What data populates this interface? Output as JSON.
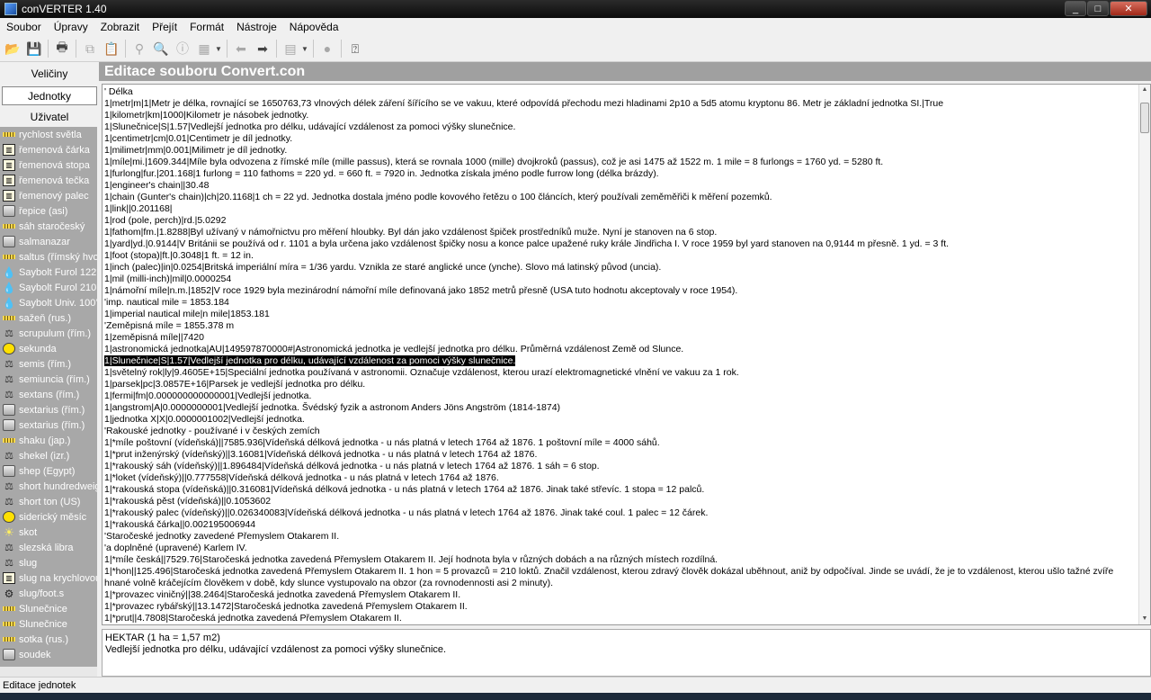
{
  "window": {
    "title": "conVERTER 1.40",
    "min": "_",
    "max": "□",
    "close": "✕"
  },
  "menu": [
    "Soubor",
    "Úpravy",
    "Zobrazit",
    "Přejít",
    "Formát",
    "Nástroje",
    "Nápověda"
  ],
  "left": {
    "tabs": [
      "Veličiny",
      "Jednotky",
      "Uživatel"
    ],
    "units": [
      {
        "label": "rychlost světla",
        "icon": "ruler"
      },
      {
        "label": "řemenová čárka",
        "icon": "frame"
      },
      {
        "label": "řemenová stopa",
        "icon": "frame"
      },
      {
        "label": "řemenová tečka",
        "icon": "frame"
      },
      {
        "label": "řemenový palec",
        "icon": "frame"
      },
      {
        "label": "řepice (asi)",
        "icon": "jar"
      },
      {
        "label": "sáh staročeský",
        "icon": "ruler"
      },
      {
        "label": "salmanazar",
        "icon": "jar"
      },
      {
        "label": "saltus (římský hvozd)",
        "icon": "ruler"
      },
      {
        "label": "Saybolt Furol 122°F",
        "icon": "drop"
      },
      {
        "label": "Saybolt Furol 210°F",
        "icon": "drop"
      },
      {
        "label": "Saybolt Univ. 100°F",
        "icon": "drop"
      },
      {
        "label": "sažeň (rus.)",
        "icon": "ruler"
      },
      {
        "label": "scrupulum (řím.)",
        "icon": "scale"
      },
      {
        "label": "sekunda",
        "icon": "clock"
      },
      {
        "label": "semis (řím.)",
        "icon": "scale"
      },
      {
        "label": "semiuncia (řím.)",
        "icon": "scale"
      },
      {
        "label": "sextans (řím.)",
        "icon": "scale"
      },
      {
        "label": "sextarius (řím.)",
        "icon": "jar"
      },
      {
        "label": "sextarius (řím.)",
        "icon": "jar"
      },
      {
        "label": "shaku (jap.)",
        "icon": "ruler"
      },
      {
        "label": "shekel (izr.)",
        "icon": "scale"
      },
      {
        "label": "shep (Egypt)",
        "icon": "jar"
      },
      {
        "label": "short hundredweight",
        "icon": "scale"
      },
      {
        "label": "short ton (US)",
        "icon": "scale"
      },
      {
        "label": "siderický měsíc",
        "icon": "clock"
      },
      {
        "label": "skot",
        "icon": "sun"
      },
      {
        "label": "slezská libra",
        "icon": "scale"
      },
      {
        "label": "slug",
        "icon": "scale"
      },
      {
        "label": "slug na krychlovou stopu",
        "icon": "frame"
      },
      {
        "label": "slug/foot.s",
        "icon": "gear"
      },
      {
        "label": "Slunečnice",
        "icon": "ruler"
      },
      {
        "label": "Slunečnice",
        "icon": "ruler"
      },
      {
        "label": "sotka (rus.)",
        "icon": "ruler"
      },
      {
        "label": "soudek",
        "icon": "jar"
      }
    ]
  },
  "main": {
    "header": "Editace souboru Convert.con",
    "lines": [
      "' Délka",
      "1|metr|m|1|Metr je délka, rovnající se 1650763,73 vlnových délek záření šířícího se ve vakuu, které odpovídá přechodu mezi hladinami 2p10 a 5d5 atomu kryptonu 86. Metr je základní jednotka SI.|True",
      "1|kilometr|km|1000|Kilometr je násobek jednotky.",
      "1|Slunečnice|S|1.57|Vedlejší jednotka pro délku, udávající vzdálenost za pomoci výšky slunečnice.",
      "1|centimetr|cm|0.01|Centimetr je díl jednotky.",
      "1|milimetr|mm|0.001|Milimetr je díl jednotky.",
      "1|míle|mi.|1609.344|Míle byla odvozena z římské míle (mille passus), která se rovnala 1000 (mille) dvojkroků (passus), což je asi 1475 až 1522 m. 1 mile = 8 furlongs = 1760 yd. = 5280 ft.",
      "1|furlong|fur.|201.168|1 furlong = 110 fathoms = 220 yd. = 660 ft. = 7920 in. Jednotka získala jméno podle furrow long (délka brázdy).",
      "1|engineer's chain||30.48",
      "1|chain (Gunter's chain)|ch|20.1168|1 ch = 22 yd. Jednotka dostala jméno podle kovového řetězu o 100 článcích, který používali zeměměřiči k měření pozemků.",
      "1|link||0.201168|",
      "1|rod (pole, perch)|rd.|5.0292",
      "1|fathom|fm.|1.8288|Byl užívaný v námořnictvu pro měření hloubky. Byl dán jako vzdálenost špiček prostředníků muže. Nyní je stanoven na 6 stop.",
      "1|yard|yd.|0.9144|V Británii se používá od r. 1101 a byla určena jako vzdálenost špičky nosu a konce palce upažené ruky krále Jindřicha I. V roce 1959 byl yard stanoven na 0,9144 m přesně. 1 yd. = 3 ft.",
      "1|foot (stopa)|ft.|0.3048|1 ft. = 12 in.",
      "1|inch (palec)|in|0.0254|Britská imperiální míra = 1/36 yardu. Vznikla ze staré anglické unce (ynche). Slovo má latinský původ (uncia).",
      "1|mil (milli-inch)|mil|0.0000254",
      "1|námořní míle|n.m.|1852|V roce 1929 byla mezinárodní námořní míle definovaná jako 1852 metrů přesně (USA tuto hodnotu akceptovaly v roce 1954).",
      "'imp. nautical mile = 1853.184",
      "1|imperial nautical mile|n mile|1853.181",
      "'Zeměpisná míle = 1855.378 m",
      "1|zeměpisná míle||7420",
      "1|astronomická jednotka|AU|149597870000#|Astronomická jednotka je vedlejší jednotka pro délku. Průměrná vzdálenost Země od Slunce.",
      "1|Slunečnice|S|1.57|Vedlejší jednotka pro délku, udávající vzdálenost za pomoci výšky slunečnice.",
      "1|světelný rok|ly|9.4605E+15|Speciální jednotka používaná v astronomii. Označuje vzdálenost, kterou urazí elektromagnetické vlnění ve vakuu za 1 rok.",
      "1|parsek|pc|3.0857E+16|Parsek je vedlejší jednotka pro délku.",
      "1|fermi|fm|0.000000000000001|Vedlejší jednotka.",
      "1|angstrom|A|0.0000000001|Vedlejší jednotka. Švédský fyzik a astronom Anders Jöns Angström (1814-1874)",
      "1|jednotka X|X|0.0000001002|Vedlejší jednotka.",
      "'Rakouské jednotky - používané i v českých zemích",
      "1|*míle poštovní (vídeňská)||7585.936|Vídeňská délková jednotka - u nás platná v letech 1764 až 1876. 1 poštovní míle = 4000 sáhů.",
      "1|*prut inženýrský (vídeňský)||3.16081|Vídeňská délková jednotka - u nás platná v letech 1764 až 1876.",
      "1|*rakouský sáh (vídeňský)||1.896484|Vídeňská délková jednotka - u nás platná v letech 1764 až 1876. 1 sáh = 6 stop.",
      "1|*loket (vídeňský)||0.777558|Vídeňská délková jednotka - u nás platná v letech 1764 až 1876.",
      "1|*rakouská stopa (vídeňská)||0.316081|Vídeňská délková jednotka - u nás platná v letech 1764 až 1876. Jinak také střevíc. 1 stopa = 12 palců.",
      "1|*rakouská pěst (vídeňská)||0.1053602",
      "1|*rakouský palec (vídeňský)||0.026340083|Vídeňská délková jednotka - u nás platná v letech 1764 až 1876. Jinak také coul. 1 palec = 12 čárek.",
      "1|*rakouská čárka||0.002195006944",
      "'Staročeské jednotky zavedené Přemyslem Otakarem II.",
      "'a doplněné (upravené) Karlem IV.",
      "1|*míle česká||7529.76|Staročeská jednotka zavedená Přemyslem Otakarem II. Její hodnota byla v různých dobách a na různých místech rozdílná.",
      "1|*hon||125.496|Staročeská jednotka zavedená Přemyslem Otakarem II. 1 hon = 5 provazců = 210 loktů. Značil vzdálenost, kterou zdravý člověk dokázal uběhnout, aniž by odpočíval. Jinde se uvádí, že je to vzdálenost, kterou ušlo tažné zvíře hnané volně kráčejícím člověkem v době, kdy slunce vystupovalo na obzor (za rovnodennosti asi 2 minuty).",
      "1|*provazec viničný||38.2464|Staročeská jednotka zavedená Přemyslem Otakarem II.",
      "1|*provazec rybářský||13.1472|Staročeská jednotka zavedená Přemyslem Otakarem II.",
      "1|*prut||4.7808|Staročeská jednotka zavedená Přemyslem Otakarem II."
    ],
    "selected_line": 23,
    "info_title": "HEKTAR (1 ha = 1,57 m2)",
    "info_text": "Vedlejší jednotka pro délku, udávající vzdálenost za pomoci výšky slunečnice."
  },
  "status": "Editace jednotek"
}
